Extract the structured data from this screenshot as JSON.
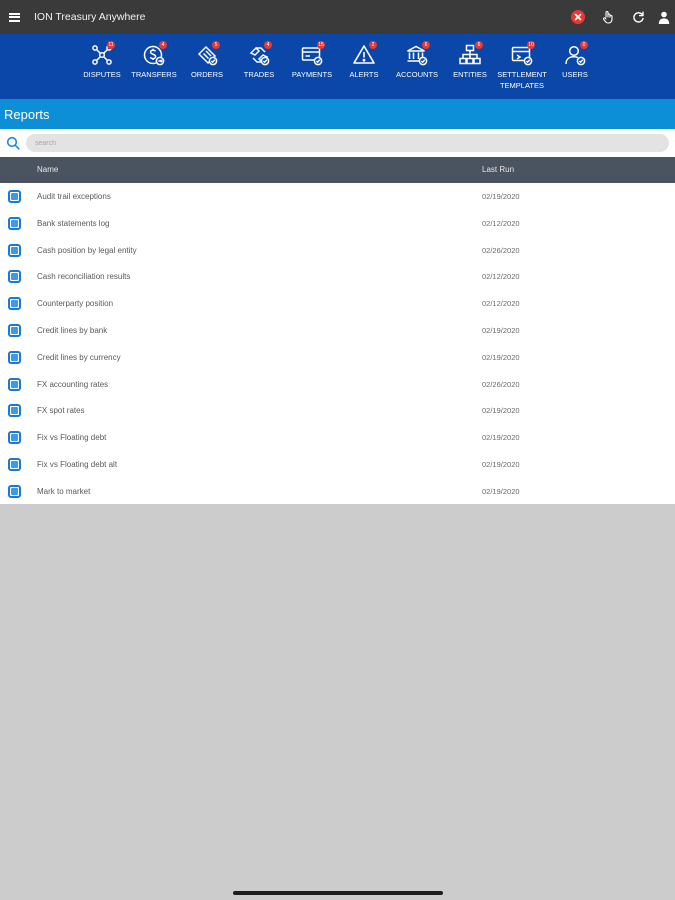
{
  "app": {
    "title": "ION Treasury Anywhere"
  },
  "title_actions": [
    {
      "icon": "close-icon"
    },
    {
      "icon": "touch-icon"
    },
    {
      "icon": "refresh-icon"
    },
    {
      "icon": "user-icon"
    }
  ],
  "nav": {
    "items": [
      {
        "label": "DISPUTES",
        "label2": "",
        "badge": "11",
        "icon": "disputes-icon"
      },
      {
        "label": "TRANSFERS",
        "label2": "",
        "badge": "4",
        "icon": "transfers-icon"
      },
      {
        "label": "ORDERS",
        "label2": "",
        "badge": "5",
        "icon": "orders-icon"
      },
      {
        "label": "TRADES",
        "label2": "",
        "badge": "4",
        "icon": "trades-icon"
      },
      {
        "label": "PAYMENTS",
        "label2": "",
        "badge": "15",
        "icon": "payments-icon"
      },
      {
        "label": "ALERTS",
        "label2": "",
        "badge": "2",
        "icon": "alerts-icon"
      },
      {
        "label": "ACCOUNTS",
        "label2": "",
        "badge": "6",
        "icon": "accounts-icon"
      },
      {
        "label": "ENTITIES",
        "label2": "",
        "badge": "6",
        "icon": "entities-icon"
      },
      {
        "label": "SETTLEMENT",
        "label2": "TEMPLATES",
        "badge": "10",
        "icon": "settlement-templates-icon"
      },
      {
        "label": "USERS",
        "label2": "",
        "badge": "0",
        "icon": "users-icon"
      }
    ]
  },
  "reports": {
    "title": "Reports"
  },
  "search": {
    "placeholder": "search"
  },
  "table": {
    "columns": {
      "name": "Name",
      "last_run": "Last Run"
    },
    "rows": [
      {
        "name": "Audit trail exceptions",
        "last_run": "02/19/2020"
      },
      {
        "name": "Bank statements log",
        "last_run": "02/12/2020"
      },
      {
        "name": "Cash position by legal entity",
        "last_run": "02/26/2020"
      },
      {
        "name": "Cash reconciliation results",
        "last_run": "02/12/2020"
      },
      {
        "name": "Counterparty position",
        "last_run": "02/12/2020"
      },
      {
        "name": "Credit lines by bank",
        "last_run": "02/19/2020"
      },
      {
        "name": "Credit lines by currency",
        "last_run": "02/19/2020"
      },
      {
        "name": "FX accounting rates",
        "last_run": "02/26/2020"
      },
      {
        "name": "FX spot rates",
        "last_run": "02/19/2020"
      },
      {
        "name": "Fix vs Floating debt",
        "last_run": "02/19/2020"
      },
      {
        "name": "Fix vs Floating debt alt",
        "last_run": "02/19/2020"
      },
      {
        "name": "Mark to market",
        "last_run": "02/19/2020"
      }
    ]
  },
  "colors": {
    "title_bar": "#3a3a3a",
    "nav_bar": "#0a47a9",
    "reports_bar": "#0d8fd8",
    "table_header": "#4a5360",
    "badge": "#e53935",
    "checkbox": "#1b78d6",
    "background": "#cccccc"
  }
}
